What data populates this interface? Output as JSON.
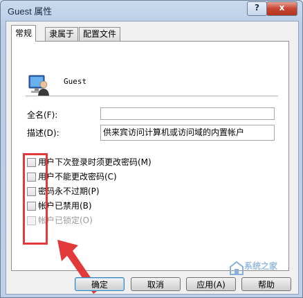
{
  "window": {
    "title": "Guest 属性",
    "help_label": "?",
    "close_label": "x"
  },
  "tabs": [
    {
      "label": "常规"
    },
    {
      "label": "隶属于"
    },
    {
      "label": "配置文件"
    }
  ],
  "user": {
    "name": "Guest",
    "icon": "user-account-icon"
  },
  "fields": {
    "fullname_label": "全名(F):",
    "fullname_value": "",
    "description_label": "描述(D):",
    "description_value": "供来宾访问计算机或访问域的内置帐户"
  },
  "checkboxes": [
    {
      "label": "用户下次登录时须更改密码(M)",
      "checked": false,
      "enabled": true
    },
    {
      "label": "用户不能更改密码(C)",
      "checked": false,
      "enabled": true
    },
    {
      "label": "密码永不过期(P)",
      "checked": false,
      "enabled": true
    },
    {
      "label": "帐户已禁用(B)",
      "checked": false,
      "enabled": true
    },
    {
      "label": "帐户已锁定(O)",
      "checked": false,
      "enabled": false
    }
  ],
  "annotation": {
    "highlight_color": "#e23a3a"
  },
  "buttons": {
    "ok": "确定",
    "cancel": "取消",
    "apply": "应用(A)",
    "help": "帮助"
  },
  "watermark": {
    "text": "系统之家",
    "logo": "watermark-logo"
  },
  "colors": {
    "window_frame": "#b9cde6",
    "close_button": "#c64531",
    "panel_bg": "#ffffff"
  }
}
